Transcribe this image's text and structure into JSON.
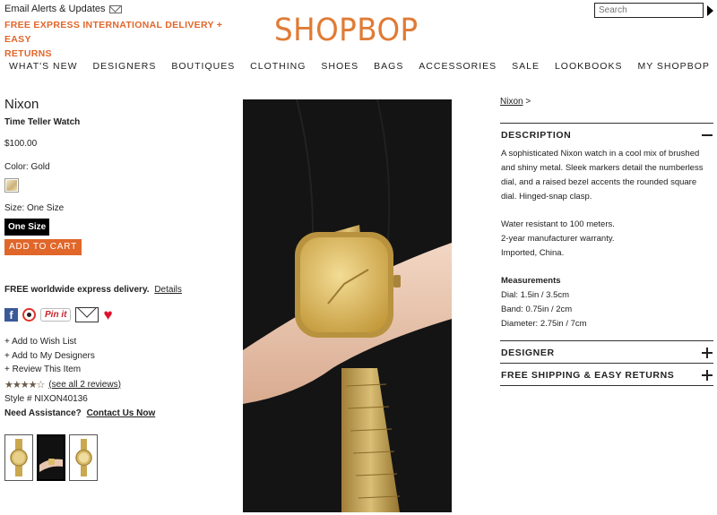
{
  "header": {
    "email_alerts": "Email Alerts & Updates",
    "promo_line1": "FREE EXPRESS INTERNATIONAL DELIVERY + EASY",
    "promo_line2": "RETURNS",
    "logo": "SHOPBOP",
    "search_placeholder": "Search"
  },
  "nav": [
    "WHAT'S NEW",
    "DESIGNERS",
    "BOUTIQUES",
    "CLOTHING",
    "SHOES",
    "BAGS",
    "ACCESSORIES",
    "SALE",
    "LOOKBOOKS",
    "MY SHOPBOP"
  ],
  "product": {
    "brand": "Nixon",
    "name": "Time Teller Watch",
    "price": "$100.00",
    "color_label": "Color: Gold",
    "size_label": "Size: One Size",
    "size_button": "One Size",
    "add_to_cart": "ADD TO CART",
    "delivery_text": "FREE worldwide express delivery.",
    "details_link": "Details",
    "pinit": "Pin it",
    "add_wish": "+ Add to Wish List",
    "add_designers": "+ Add to My Designers",
    "review_item": "+ Review This Item",
    "rating": 4,
    "stars": "★★★★☆",
    "reviews_link": "(see all 2 reviews)",
    "style_no": "Style # NIXON40136",
    "assist_label": "Need Assistance?",
    "assist_link": "Contact Us Now"
  },
  "right": {
    "breadcrumb": "Nixon",
    "breadcrumb_sep": " >",
    "description_title": "DESCRIPTION",
    "desc_p1": "A sophisticated Nixon watch in a cool mix of brushed and shiny metal. Sleek markers detail the numberless dial, and a raised bezel accents the rounded square dial. Hinged-snap clasp.",
    "desc_l1": "Water resistant to 100 meters.",
    "desc_l2": "2-year manufacturer warranty.",
    "desc_l3": "Imported, China.",
    "meas_title": "Measurements",
    "meas_1": "Dial: 1.5in / 3.5cm",
    "meas_2": "Band: 0.75in / 2cm",
    "meas_3": "Diameter: 2.75in / 7cm",
    "designer_title": "DESIGNER",
    "shipping_title": "FREE SHIPPING & EASY RETURNS"
  },
  "colors": {
    "accent": "#e0662a",
    "logo": "#e07b35"
  }
}
